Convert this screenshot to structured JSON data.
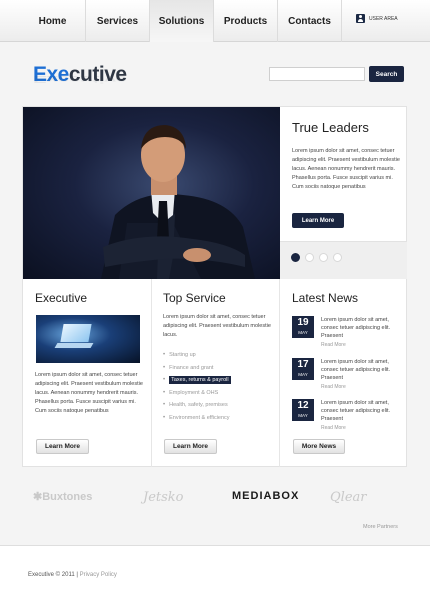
{
  "nav": {
    "items": [
      {
        "label": "Home"
      },
      {
        "label": "Services"
      },
      {
        "label": "Solutions"
      },
      {
        "label": "Products"
      },
      {
        "label": "Contacts"
      }
    ],
    "user_label": "USER AREA"
  },
  "header": {
    "logo_accent": "Exe",
    "logo_rest": "cutive",
    "search_placeholder": "",
    "search_button": "Search"
  },
  "slider": {
    "title": "True Leaders",
    "text": "Lorem ipsum dolor sit amet, consec tetuer adipiscing elit. Praesent vestibulum molestie lacus. Aenean nonummy hendrerit mauris. Phasellus porta. Fusce suscipit varius mi. Cum sociis natoque penatibus",
    "button": "Learn More",
    "active_slide": 1,
    "slide_count": 4
  },
  "columns": {
    "executive": {
      "title": "Executive",
      "text": "Lorem ipsum dolor sit amet, consec tetuer adipiscing elit. Praesent vestibulum molestie lacus. Aenean nonummy hendrerit mauris. Phasellus porta. Fusce suscipit varius mi. Cum sociis natoque penatibus",
      "button": "Learn More"
    },
    "top_service": {
      "title": "Top Service",
      "text": "Lorem ipsum dolor sit amet, consec tetuer adipiscing elit. Praesent vestibulum molestie lacus.",
      "items": [
        {
          "label": "Starting up"
        },
        {
          "label": "Finance and grant"
        },
        {
          "label": "Taxes, returns & payroll"
        },
        {
          "label": "Employment & OHS"
        },
        {
          "label": "Health, safety, premises"
        },
        {
          "label": "Environment & efficiency"
        }
      ],
      "active_item": 2,
      "button": "Learn More"
    },
    "latest_news": {
      "title": "Latest News",
      "items": [
        {
          "day": "19",
          "month": "MAY",
          "text": "Lorem ipsum dolor sit amet, consec tetuer adipiscing elit. Praesent",
          "more": "Read More"
        },
        {
          "day": "17",
          "month": "MAY",
          "text": "Lorem ipsum dolor sit amet, consec tetuer adipiscing elit. Praesent",
          "more": "Read More"
        },
        {
          "day": "12",
          "month": "MAY",
          "text": "Lorem ipsum dolor sit amet, consec tetuer adipiscing elit. Praesent",
          "more": "Read More"
        }
      ],
      "button": "More News"
    }
  },
  "partners": {
    "items": [
      {
        "name": "Buxtones"
      },
      {
        "name": "Jetsko"
      },
      {
        "name": "MEDIABOX"
      },
      {
        "name": "Qlear"
      }
    ],
    "more": "More Partners"
  },
  "footer": {
    "copyright": "Executive © 2011",
    "separator": "|",
    "privacy": "Privacy Policy"
  },
  "colors": {
    "accent": "#1e6fd4",
    "dark": "#1a2540"
  }
}
